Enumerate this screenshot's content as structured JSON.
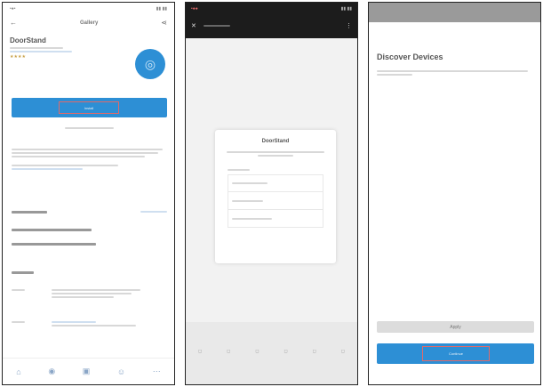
{
  "panel1": {
    "header_title": "Gallery",
    "app_name": "DoorStand",
    "primary_button": "Install"
  },
  "panel2": {
    "dialog_title": "DoorStand"
  },
  "panel3": {
    "title": "Discover Devices",
    "apply_label": "Apply",
    "primary_button": "Continue"
  }
}
